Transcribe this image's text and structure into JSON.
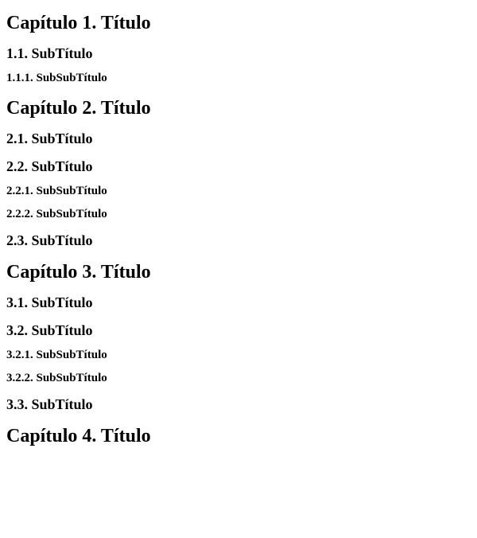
{
  "headings": [
    {
      "level": 1,
      "name": "chapter-1-title",
      "text": "Capítulo 1. Título"
    },
    {
      "level": 2,
      "name": "section-1-1-title",
      "text": "1.1. SubTítulo"
    },
    {
      "level": 3,
      "name": "section-1-1-1-title",
      "text": "1.1.1. SubSubTítulo"
    },
    {
      "level": 1,
      "name": "chapter-2-title",
      "text": "Capítulo 2. Título"
    },
    {
      "level": 2,
      "name": "section-2-1-title",
      "text": "2.1. SubTítulo"
    },
    {
      "level": 2,
      "name": "section-2-2-title",
      "text": "2.2. SubTítulo"
    },
    {
      "level": 3,
      "name": "section-2-2-1-title",
      "text": "2.2.1. SubSubTítulo"
    },
    {
      "level": 3,
      "name": "section-2-2-2-title",
      "text": "2.2.2. SubSubTítulo"
    },
    {
      "level": 2,
      "name": "section-2-3-title",
      "text": "2.3. SubTítulo"
    },
    {
      "level": 1,
      "name": "chapter-3-title",
      "text": "Capítulo 3. Título"
    },
    {
      "level": 2,
      "name": "section-3-1-title",
      "text": "3.1. SubTítulo"
    },
    {
      "level": 2,
      "name": "section-3-2-title",
      "text": "3.2. SubTítulo"
    },
    {
      "level": 3,
      "name": "section-3-2-1-title",
      "text": "3.2.1. SubSubTítulo"
    },
    {
      "level": 3,
      "name": "section-3-2-2-title",
      "text": "3.2.2. SubSubTítulo"
    },
    {
      "level": 2,
      "name": "section-3-3-title",
      "text": "3.3. SubTítulo"
    },
    {
      "level": 1,
      "name": "chapter-4-title",
      "text": "Capítulo 4. Título"
    }
  ]
}
